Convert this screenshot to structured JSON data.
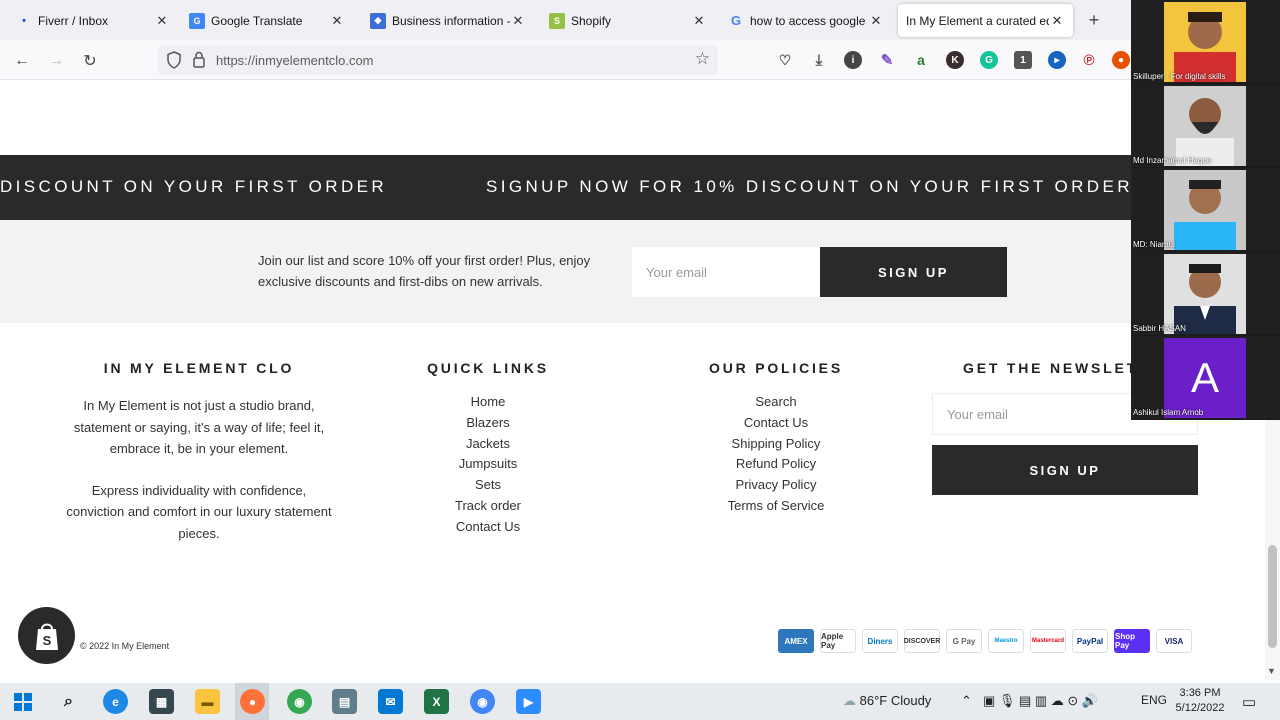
{
  "browser": {
    "tabs": [
      {
        "label": "Fiverr / Inbox",
        "icon": "fiverr-icon"
      },
      {
        "label": "Google Translate",
        "icon": "google-translate-icon"
      },
      {
        "label": "Business information - M",
        "icon": "business-icon"
      },
      {
        "label": "Shopify",
        "icon": "shopify-icon"
      },
      {
        "label": "how to access google me",
        "icon": "google-icon"
      },
      {
        "label": "In My Element a curated edit",
        "icon": "",
        "active": true
      }
    ],
    "url": "https://inmyelementclo.com"
  },
  "marquee": {
    "items": [
      "DISCOUNT ON YOUR FIRST ORDER",
      "SIGNUP NOW FOR 10% DISCOUNT ON YOUR FIRST ORDER"
    ]
  },
  "signup": {
    "text": "Join our list and score 10% off your first order! Plus, enjoy exclusive discounts and first-dibs on new arrivals.",
    "placeholder": "Your email",
    "button": "SIGN UP"
  },
  "footer": {
    "brand": {
      "heading": "IN MY ELEMENT CLO",
      "para1": "In My Element is not just a studio brand, statement or saying, it's a way of life; feel it, embrace it, be in your element.",
      "para2": "Express individuality with confidence, conviction and comfort in our luxury statement pieces."
    },
    "quick_links": {
      "heading": "QUICK LINKS",
      "items": [
        "Home",
        "Blazers",
        "Jackets",
        "Jumpsuits",
        "Sets",
        "Track order",
        "Contact Us"
      ]
    },
    "policies": {
      "heading": "OUR POLICIES",
      "items": [
        "Search",
        "Contact Us",
        "Shipping Policy",
        "Refund Policy",
        "Privacy Policy",
        "Terms of Service"
      ]
    },
    "newsletter": {
      "heading": "GET THE NEWSLETTER",
      "placeholder": "Your email",
      "button": "SIGN UP"
    },
    "copyright": "© 2022 In My Element",
    "payments": [
      "AMEX",
      "Apple Pay",
      "Diners",
      "DISCOVER",
      "G Pay",
      "Maestro",
      "Mastercard",
      "PayPal",
      "Shop Pay",
      "VISA"
    ]
  },
  "participants": [
    {
      "name": "Skilluper - For digital skills"
    },
    {
      "name": "Md Inzamamul Haque"
    },
    {
      "name": "MD: Niamul"
    },
    {
      "name": "Sabbir HASAN"
    },
    {
      "name": "Ashikul Islam Arnob",
      "initial": "A"
    }
  ],
  "taskbar": {
    "weather": "86°F  Cloudy",
    "lang": "ENG",
    "time": "3:36 PM",
    "date": "5/12/2022"
  }
}
